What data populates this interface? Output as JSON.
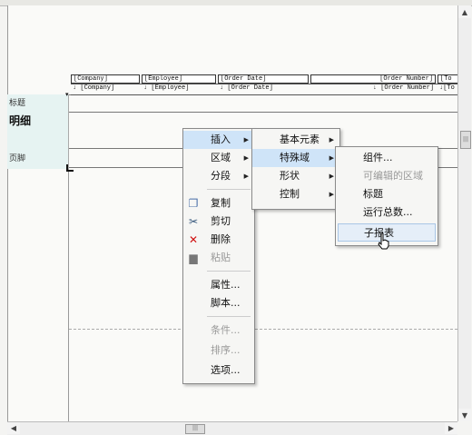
{
  "report": {
    "header_fields": [
      "[Company]",
      "[Employee]",
      "[Order Date]",
      "[Order Number]",
      "[To"
    ],
    "row_fields": [
      "[Company]",
      "[Employee]",
      "[Order Date]",
      "[Order Number]",
      "[To"
    ],
    "sort_mark": "↓",
    "sections": {
      "title": "标题",
      "detail": "明细",
      "footer": "页脚"
    }
  },
  "context_menu": {
    "items": [
      {
        "label": "插入",
        "icon": null,
        "enabled": true,
        "submenu": true
      },
      {
        "label": "区域",
        "icon": null,
        "enabled": true,
        "submenu": true
      },
      {
        "label": "分段",
        "icon": null,
        "enabled": true,
        "submenu": true
      },
      {
        "label": "复制",
        "icon": "copy-icon",
        "enabled": true
      },
      {
        "label": "剪切",
        "icon": "scissors-icon",
        "enabled": true
      },
      {
        "label": "删除",
        "icon": "delete-x-icon",
        "enabled": true
      },
      {
        "label": "粘贴",
        "icon": "paste-icon",
        "enabled": false
      },
      {
        "label": "属性...",
        "enabled": true
      },
      {
        "label": "脚本...",
        "enabled": true
      },
      {
        "label": "条件...",
        "enabled": false
      },
      {
        "label": "排序...",
        "enabled": false
      },
      {
        "label": "选项...",
        "enabled": true
      }
    ]
  },
  "insert_submenu": {
    "items": [
      {
        "label": "基本元素",
        "submenu": true
      },
      {
        "label": "特殊域",
        "submenu": true
      },
      {
        "label": "形状",
        "submenu": true
      },
      {
        "label": "控制",
        "submenu": true
      }
    ]
  },
  "special_field_submenu": {
    "items": [
      {
        "label": "组件...",
        "enabled": true
      },
      {
        "label": "可编辑的区域",
        "enabled": false
      },
      {
        "label": "标题",
        "enabled": true
      },
      {
        "label": "运行总数...",
        "enabled": true
      },
      {
        "label": "子报表",
        "enabled": true
      }
    ]
  },
  "scrollbar": {
    "grip": "|||"
  },
  "colors": {
    "highlight": "#cfe4f8",
    "band": "#e6f3f2"
  }
}
